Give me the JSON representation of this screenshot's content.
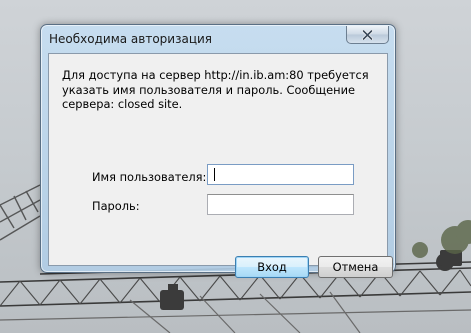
{
  "dialog": {
    "title": "Необходима авторизация",
    "message": "Для доступа на сервер http://in.ib.am:80 требуется указать имя пользователя и пароль. Сообщение сервера: closed site.",
    "username_label": "Имя пользователя:",
    "username_value": "",
    "password_label": "Пароль:",
    "password_value": "",
    "login_button": "Вход",
    "cancel_button": "Отмена",
    "close_icon": "close-icon"
  },
  "colors": {
    "titlebar": "#c6def2",
    "client_bg": "#f0f0f0",
    "default_button": "#bee6fd"
  }
}
